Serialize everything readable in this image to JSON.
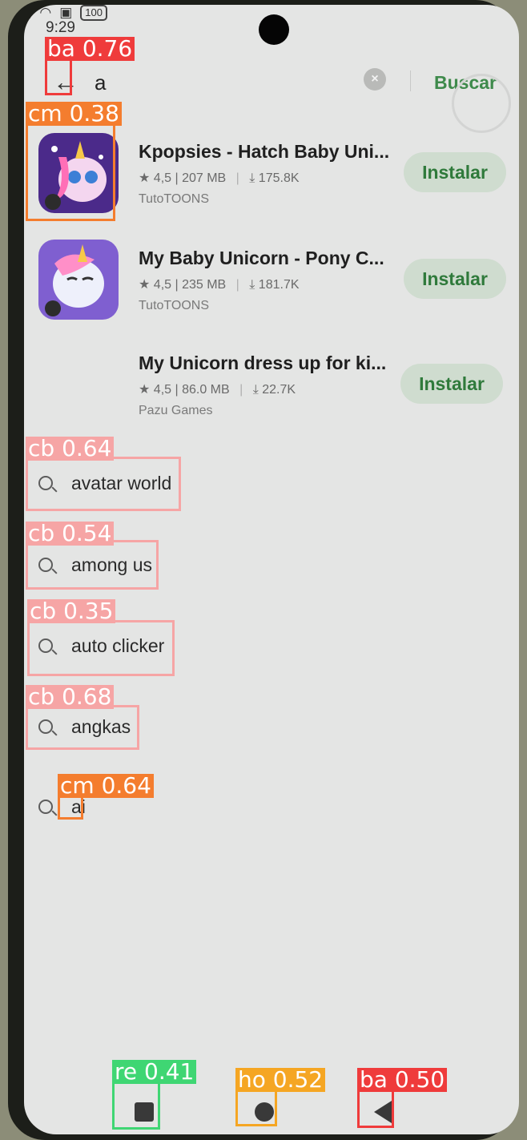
{
  "status_bar": {
    "time": "9:29",
    "battery": "100"
  },
  "search": {
    "query": "a",
    "submit_label": "Buscar"
  },
  "apps": [
    {
      "name": "Kpopsies - Hatch Baby Uni...",
      "rating": "★ 4,5 | 207 MB",
      "downloads": "⤓ 175.8K",
      "developer": "TutoTOONS",
      "install_label": "Instalar"
    },
    {
      "name": "My Baby Unicorn - Pony C...",
      "rating": "★ 4,5 | 235 MB",
      "downloads": "⤓ 181.7K",
      "developer": "TutoTOONS",
      "install_label": "Instalar"
    },
    {
      "name": "My Unicorn dress up for ki...",
      "rating": "★ 4,5 | 86.0 MB",
      "downloads": "⤓ 22.7K",
      "developer": "Pazu Games",
      "install_label": "Instalar"
    }
  ],
  "suggestions": [
    "avatar world",
    "among us",
    "auto clicker",
    "angkas",
    "ai"
  ],
  "detections": [
    {
      "label": "ba 0.76",
      "color": "#ef3b3b"
    },
    {
      "label": "cm 0.38",
      "color": "#f47d2e"
    },
    {
      "label": "cb 0.64",
      "color": "#f6a5a5"
    },
    {
      "label": "cb 0.54",
      "color": "#f6a5a5"
    },
    {
      "label": "cb 0.35",
      "color": "#f6a5a5"
    },
    {
      "label": "cb 0.68",
      "color": "#f6a5a5"
    },
    {
      "label": "cm 0.64",
      "color": "#f47d2e"
    },
    {
      "label": "re 0.41",
      "color": "#3fd673"
    },
    {
      "label": "ho 0.52",
      "color": "#f5a623"
    },
    {
      "label": "ba 0.50",
      "color": "#ef3b3b"
    }
  ],
  "icons": {
    "back": "arrow-left-icon",
    "clear": "clear-icon",
    "search": "search-icon",
    "recents": "square-icon",
    "home": "circle-icon",
    "nav_back": "triangle-icon"
  }
}
